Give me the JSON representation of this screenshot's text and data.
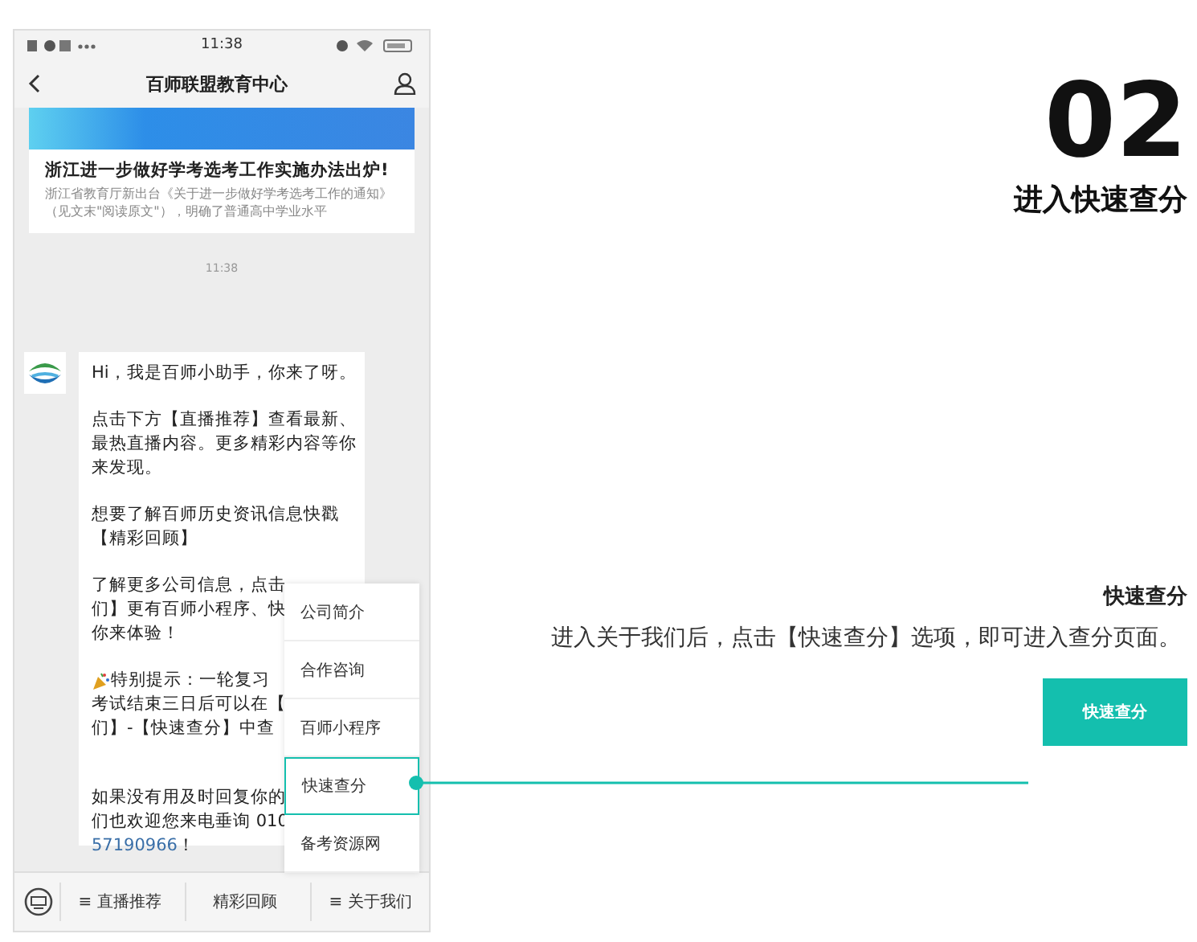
{
  "phone": {
    "status_bar": {
      "time": "11:38"
    },
    "nav": {
      "title": "百师联盟教育中心"
    },
    "article": {
      "title": "浙江进一步做好学考选考工作实施办法出炉!",
      "summary": "浙江省教育厅新出台《关于进一步做好学考选考工作的通知》（见文末\"阅读原文\"），明确了普通高中学业水平"
    },
    "timestamp": "11:38",
    "message": {
      "paragraphs": [
        {
          "lines": [
            "Hi，我是百师小助手，你来了呀。"
          ]
        },
        {
          "lines": [
            "点击下方【直播推荐】查看最新、",
            "最热直播内容。更多精彩内容等你",
            "来发现。"
          ]
        },
        {
          "lines": [
            "想要了解百师历史资讯信息快戳",
            "【精彩回顾】"
          ]
        },
        {
          "lines": [
            "了解更多公司信息，点击",
            "们】更有百师小程序、快",
            "你来体验！"
          ]
        },
        {
          "lines": [
            "特别提示：一轮复习",
            "考试结束三日后可以在【",
            "们】-【快速查分】中查"
          ],
          "party_icon": true,
          "extra_gap": true
        },
        {
          "lines": [
            "如果没有用及时回复你的",
            "们也欢迎您来电垂询 010"
          ],
          "phone_number": "57190966",
          "tail": "！"
        }
      ]
    },
    "menu": [
      {
        "label": "公司简介",
        "selected": false
      },
      {
        "label": "合作咨询",
        "selected": false
      },
      {
        "label": "百师小程序",
        "selected": false
      },
      {
        "label": "快速查分",
        "selected": true
      },
      {
        "label": "备考资源网",
        "selected": false
      }
    ],
    "bottom_bar": [
      "≡ 直播推荐",
      "精彩回顾",
      "≡ 关于我们"
    ]
  },
  "step": {
    "number": "02",
    "title": "进入快速查分"
  },
  "callout": {
    "heading": "快速查分",
    "description": "进入关于我们后，点击【快速查分】选项，即可进入查分页面。",
    "button": "快速查分"
  }
}
